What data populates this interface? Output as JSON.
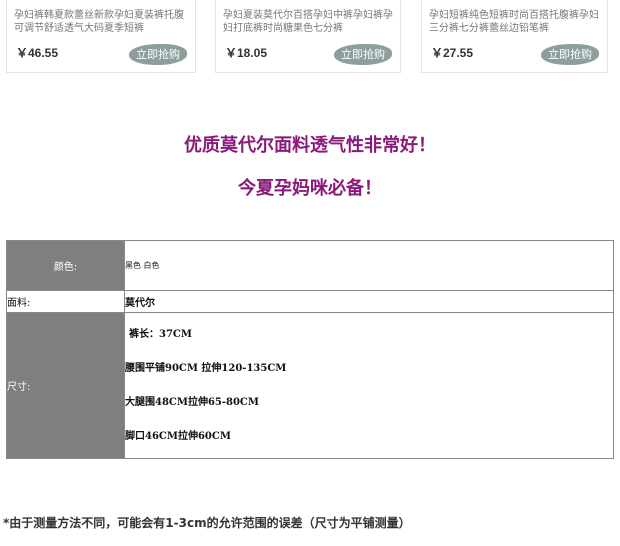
{
  "products": [
    {
      "title_lines": [
        "孕妇裤韩夏款蕾丝新款孕妇夏装裤托腹",
        "可调节舒适透气大码夏季短裤"
      ],
      "price": "￥46.55",
      "buy_label": "立即抢购"
    },
    {
      "title_lines": [
        "孕妇夏装莫代尔百搭孕妇中裤孕妇裤孕",
        "妇打底裤时尚糖果色七分裤"
      ],
      "price": "￥18.05",
      "buy_label": "立即抢购"
    },
    {
      "title_lines": [
        "孕妇短裤纯色短裤时尚百搭托腹裤孕妇",
        "三分裤七分裤蕾丝边铅笔裤"
      ],
      "price": "￥27.55",
      "buy_label": "立即抢购"
    }
  ],
  "slogan": {
    "line1": "优质莫代尔面料透气性非常好！",
    "line2": "今夏孕妈咪必备！"
  },
  "spec": {
    "color_label": "颜色:",
    "color_value": "黑色 白色",
    "fabric_label": "面料:",
    "fabric_value": "莫代尔",
    "size_label": "尺寸:",
    "size_lines": [
      "裤长：37CM",
      "腰围平铺90CM 拉伸120-135CM",
      "大腿围48CM拉伸65-80CM",
      "脚口46CM拉伸60CM"
    ]
  },
  "note": "*由于测量方法不同，可能会有1-3cm的允许范围的误差（尺寸为平铺测量）",
  "colors": {
    "slogan": "#8a1a7a",
    "label_bg": "#7f7f7f",
    "buy_button": "#7a8f8c"
  }
}
